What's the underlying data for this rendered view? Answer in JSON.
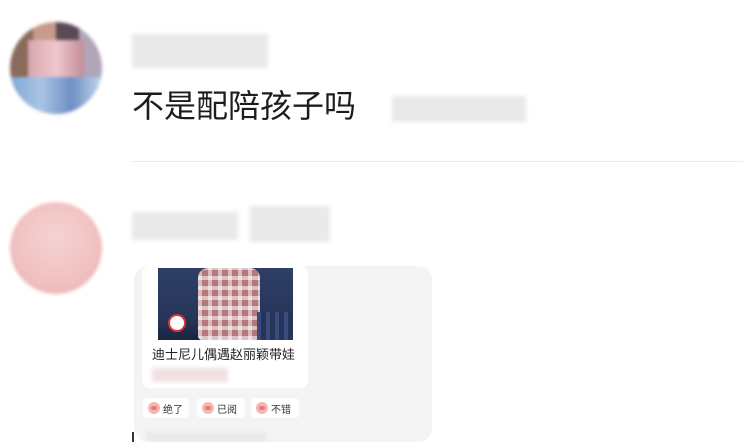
{
  "comments": [
    {
      "text": "不是配陪孩子吗"
    },
    {
      "link_card": {
        "title": "迪士尼儿偶遇赵丽颖带娃"
      },
      "reactions": [
        {
          "label": "绝了",
          "icon": "pig-face-icon"
        },
        {
          "label": "已阅",
          "icon": "peach-icon"
        },
        {
          "label": "不错",
          "icon": "pig-face-icon"
        }
      ]
    }
  ]
}
